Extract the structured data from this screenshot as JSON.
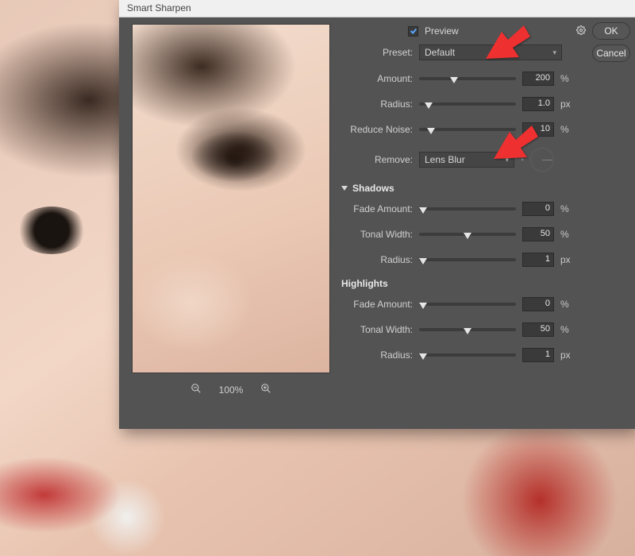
{
  "titlebar": "Smart Sharpen",
  "preview": {
    "checkbox_label": "Preview",
    "checked": true,
    "zoom": "100%"
  },
  "buttons": {
    "ok": "OK",
    "cancel": "Cancel"
  },
  "preset": {
    "label": "Preset:",
    "value": "Default"
  },
  "sliders": {
    "amount": {
      "label": "Amount:",
      "value": "200",
      "unit": "%",
      "pos": 36
    },
    "radius": {
      "label": "Radius:",
      "value": "1.0",
      "unit": "px",
      "pos": 10
    },
    "reduce_noise": {
      "label": "Reduce Noise:",
      "value": "10",
      "unit": "%",
      "pos": 12
    }
  },
  "remove": {
    "label": "Remove:",
    "value": "Lens Blur"
  },
  "sections": {
    "shadows": {
      "title": "Shadows",
      "fade_amount": {
        "label": "Fade Amount:",
        "value": "0",
        "unit": "%",
        "pos": 4
      },
      "tonal_width": {
        "label": "Tonal Width:",
        "value": "50",
        "unit": "%",
        "pos": 50
      },
      "radius": {
        "label": "Radius:",
        "value": "1",
        "unit": "px",
        "pos": 4
      }
    },
    "highlights": {
      "title": "Highlights",
      "fade_amount": {
        "label": "Fade Amount:",
        "value": "0",
        "unit": "%",
        "pos": 4
      },
      "tonal_width": {
        "label": "Tonal Width:",
        "value": "50",
        "unit": "%",
        "pos": 50
      },
      "radius": {
        "label": "Radius:",
        "value": "1",
        "unit": "px",
        "pos": 4
      }
    }
  }
}
